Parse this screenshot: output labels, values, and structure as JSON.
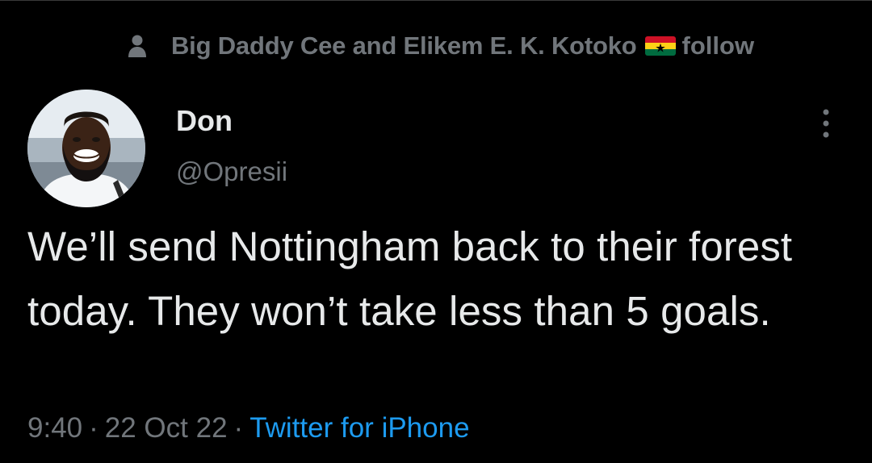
{
  "social_context": {
    "names": "Big Daddy Cee and Elikem E. K. Kotoko",
    "follow_label": "follow",
    "icon": "person-icon",
    "flag_icon": "ghana-flag-icon"
  },
  "author": {
    "display_name": "Don",
    "handle": "@Opresii"
  },
  "tweet": {
    "text": "We’ll send Nottingham back to their forest today. They won’t take less than 5 goals."
  },
  "meta": {
    "time": "9:40",
    "date": "22 Oct 22",
    "separator": "·",
    "source": "Twitter for iPhone"
  },
  "colors": {
    "background": "#000000",
    "primary_text": "#e7e9ea",
    "secondary_text": "#71767b",
    "link": "#1d9bf0"
  }
}
